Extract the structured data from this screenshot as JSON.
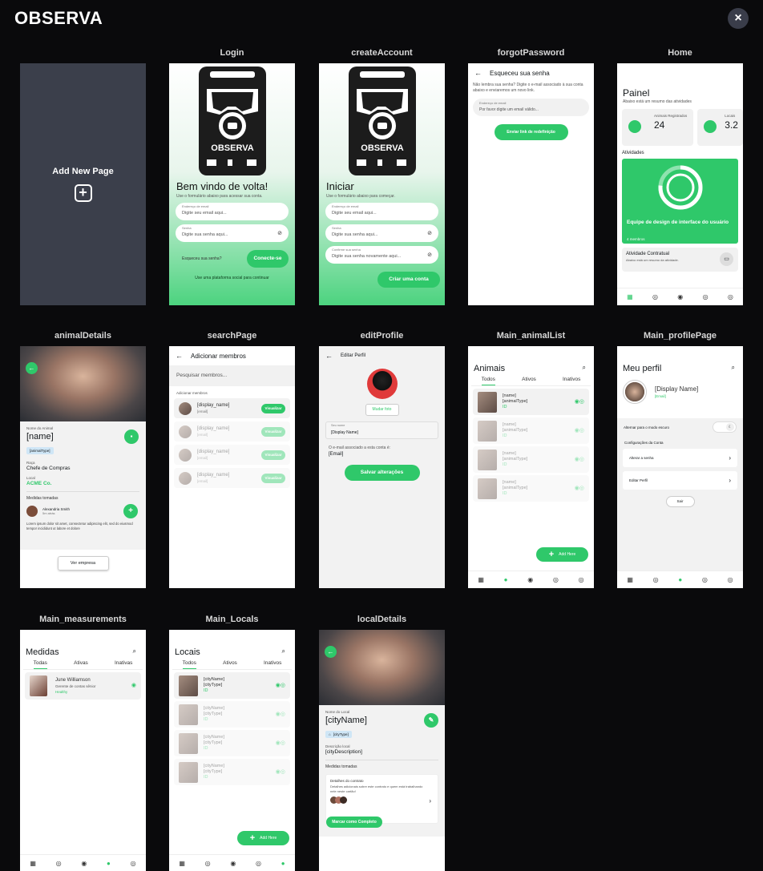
{
  "app": {
    "title": "OBSERVA",
    "close": "×"
  },
  "pages": {
    "add_new": {
      "label": "Add New Page",
      "icon": "+"
    },
    "login": {
      "name": "Login",
      "logo": "OBSERVA",
      "heading": "Bem vindo de volta!",
      "sub": "Use o formulário abaixo para acessar sua conta.",
      "email_label": "Endereço de email",
      "email_ph": "Digite seu email aqui...",
      "pass_label": "Senha",
      "pass_ph": "Digite sua senha aqui...",
      "forgot": "Esqueceu sua senha?",
      "connect": "Conecte-se",
      "footer": "Use uma plataforma social para continuar"
    },
    "create": {
      "name": "createAccount",
      "logo": "OBSERVA",
      "heading": "Iniciar",
      "sub": "Use o formulário abaixo para começar.",
      "email_label": "Endereço de email",
      "email_ph": "Digite seu email aqui...",
      "pass_label": "Senha",
      "pass_ph": "Digite sua senha aqui...",
      "confirm_label": "Confirme sua senha",
      "confirm_ph": "Digite sua senha novamente aqui...",
      "btn": "Criar uma conta"
    },
    "forgot": {
      "name": "forgotPassword",
      "title": "Esqueceu sua senha",
      "desc": "Não lembra sua senha? Digite o e-mail associado à sua conta abaixo e enviaremos um novo link.",
      "email_label": "Endereço de email",
      "email_ph": "Por favor digite um email válido...",
      "btn": "Enviar link de redefinição"
    },
    "home": {
      "name": "Home",
      "title": "Painel",
      "sub": "Abaixo está um resumo das atividades",
      "stat1_label": "Animais Registrados",
      "stat1_value": "24",
      "stat2_label": "Locais",
      "stat2_value": "3.2",
      "activities": "Atividades",
      "team": "Equipe de design de interface do usuário",
      "members": "4 membros",
      "contract": "Atividade Contratual",
      "contract_sub": "Abaixo está um resumo da atividade."
    },
    "animal_details": {
      "name": "animalDetails",
      "name_label": "Nome do Animal",
      "name_value": "[name]",
      "type": "[animalType]",
      "breed_label": "Raça",
      "breed": "Chefe de Compras",
      "local_label": "Local",
      "local": "ACME Co.",
      "measures": "Medidas tomadas",
      "person": "Alexandria Smith",
      "person_time": "5m atrás",
      "lorem": "Lorem ipsum dolor sit amet, consectetur adipiscing elit, sed do eiusmod tempor incididunt ut labore et dolore",
      "btn": "Ver empresa"
    },
    "search": {
      "name": "searchPage",
      "title": "Adicionar membros",
      "search_ph": "Pesquisar membros...",
      "section": "Adicionar membros",
      "rows": [
        {
          "name": "[display_name]",
          "sub": "[email]",
          "btn": "Visualizar"
        },
        {
          "name": "[display_name]",
          "sub": "[email]",
          "btn": "Visualizar"
        },
        {
          "name": "[display_name]",
          "sub": "[email]",
          "btn": "Visualizar"
        },
        {
          "name": "[display_name]",
          "sub": "[email]",
          "btn": "Visualizar"
        }
      ]
    },
    "edit_profile": {
      "name": "editProfile",
      "title": "Editar Perfil",
      "change_photo": "Mudar foto",
      "name_label": "Seu nome",
      "name_value": "[Display Name]",
      "email_label": "O e-mail associado a esta conta é:",
      "email_value": "[Email]",
      "save": "Salvar alterações"
    },
    "animal_list": {
      "name": "Main_animalList",
      "title": "Animais",
      "tabs": [
        "Todos",
        "Ativos",
        "Inativos"
      ],
      "rows": [
        {
          "name": "[name]",
          "type": "[animalType]",
          "id": "ID"
        },
        {
          "name": "[name]",
          "type": "[animalType]",
          "id": "ID"
        },
        {
          "name": "[name]",
          "type": "[animalType]",
          "id": "ID"
        },
        {
          "name": "[name]",
          "type": "[animalType]",
          "id": "ID"
        }
      ],
      "add": "Add Here"
    },
    "profile": {
      "name": "Main_profilePage",
      "title": "Meu perfil",
      "display_name": "[Display Name]",
      "email": "[Email]",
      "dark": "Alternar para o modo escuro",
      "config": "Configurações da Conta",
      "change_pass": "Alterar a senha",
      "edit": "Editar Perfil",
      "logout": "Sair"
    },
    "measurements": {
      "name": "Main_measurements",
      "title": "Medidas",
      "tabs": [
        "Todas",
        "Ativas",
        "Inativas"
      ],
      "person": "June Williamson",
      "role": "Gerente de contas sênior",
      "status": "Healthy"
    },
    "locals": {
      "name": "Main_Locals",
      "title": "Locais",
      "tabs": [
        "Todos",
        "Ativos",
        "Inativos"
      ],
      "rows": [
        {
          "name": "[cityName]",
          "type": "[cityType]",
          "id": "ID"
        },
        {
          "name": "[cityName]",
          "type": "[cityType]",
          "id": "ID"
        },
        {
          "name": "[cityName]",
          "type": "[cityType]",
          "id": "ID"
        },
        {
          "name": "[cityName]",
          "type": "[cityType]",
          "id": "ID"
        }
      ],
      "add": "Add Here"
    },
    "local_details": {
      "name": "localDetails",
      "name_label": "Nome do Local",
      "name_value": "[cityName]",
      "type": "[cityType]",
      "desc_label": "Descrição local",
      "desc": "[cityDescription]",
      "measures": "Medidas tomadas",
      "contract_title": "Detalhes do contrato",
      "contract_desc": "Detalhes adicionais sobre este contrato e quem está trabalhando nele neste cartão!",
      "btn": "Marcar como Completo"
    }
  },
  "colors": {
    "accent": "#2fc86a",
    "bg": "#0a0a0c",
    "add_card": "#3b3f4b"
  }
}
